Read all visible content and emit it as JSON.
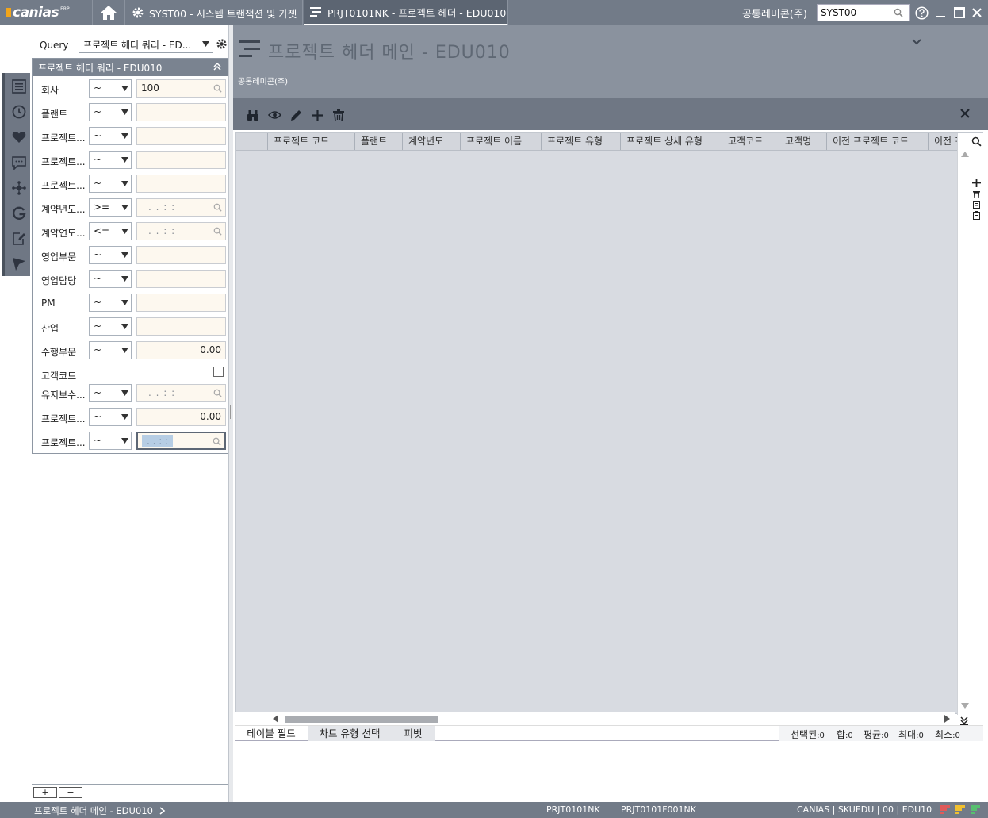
{
  "app": {
    "logo": "canias",
    "logo_sup": "ERP"
  },
  "tabs": [
    {
      "label": "SYST00 - 시스템 트랜잭션 및 가젯",
      "icon": "gear-icon"
    },
    {
      "label": "PRJT0101NK - 프로젝트 헤더 - EDU010",
      "icon": "menu-icon",
      "active": true
    }
  ],
  "header_right": {
    "company": "공통레미콘(주)",
    "user": "SYST00"
  },
  "query": {
    "label": "Query",
    "selected": "프로젝트 헤더 쿼리 - ED...",
    "panel_title": "프로젝트 헤더 쿼리 - EDU010",
    "fields": [
      {
        "label": "회사",
        "op": "~",
        "value": "100",
        "kind": "search"
      },
      {
        "label": "플랜트",
        "op": "~",
        "value": "",
        "kind": "text"
      },
      {
        "label": "프로젝트...",
        "op": "~",
        "value": "",
        "kind": "text"
      },
      {
        "label": "프로젝트...",
        "op": "~",
        "value": "",
        "kind": "text"
      },
      {
        "label": "프로젝트...",
        "op": "~",
        "value": "",
        "kind": "text"
      },
      {
        "label": "계약년도...",
        "op": ">=",
        "value": ". .   : :",
        "kind": "date"
      },
      {
        "label": "계약연도...",
        "op": "<=",
        "value": ". .   : :",
        "kind": "date"
      },
      {
        "label": "영업부문",
        "op": "~",
        "value": "",
        "kind": "text"
      },
      {
        "label": "영업담당",
        "op": "~",
        "value": "",
        "kind": "text"
      },
      {
        "label": "PM",
        "op": "~",
        "value": "",
        "kind": "text"
      },
      {
        "label": "산업",
        "op": "~",
        "value": "",
        "kind": "text"
      },
      {
        "label": "수행부문",
        "op": "~",
        "value": "0.00",
        "kind": "number"
      },
      {
        "label": "고객코드",
        "op": "",
        "value": "",
        "kind": "checkbox"
      },
      {
        "label": "유지보수...",
        "op": "~",
        "value": ". .   : :",
        "kind": "date"
      },
      {
        "label": "프로젝트...",
        "op": "~",
        "value": "0.00",
        "kind": "number"
      },
      {
        "label": "프로젝트...",
        "op": "~",
        "value": ". .   : :",
        "kind": "date-active"
      }
    ],
    "add_label": "+",
    "remove_label": "−"
  },
  "main": {
    "title": "프로젝트 헤더 메인 - EDU010",
    "subtitle": "공통레미콘(주)",
    "columns": [
      "",
      "프로젝트 코드",
      "플랜트",
      "계약년도",
      "프로젝트 이름",
      "프로젝트 유형",
      "프로젝트 상세 유형",
      "고객코드",
      "고객명",
      "이전 프로젝트 코드",
      "이전 프"
    ],
    "bottom_tabs": [
      "테이블 필드",
      "차트 유형 선택",
      "피벗"
    ],
    "stats": [
      {
        "label": "선택된",
        "value": ":0"
      },
      {
        "label": "합",
        "value": ":0"
      },
      {
        "label": "평균",
        "value": ":0"
      },
      {
        "label": "최대",
        "value": ":0"
      },
      {
        "label": "최소",
        "value": ":0"
      }
    ]
  },
  "statusbar": {
    "breadcrumb": "프로젝트 헤더 메인 - EDU010",
    "code1": "PRJT0101NK",
    "code2": "PRJT0101F001NK",
    "session": "CANIAS | SKUEDU | 00 | EDU10"
  },
  "colors": {
    "header": "#727b88",
    "active_tab": "#5c6572",
    "field_bg": "#fdf8ef",
    "grid_bg": "#d8dbe1",
    "logo_accent": "#f2a51a"
  }
}
